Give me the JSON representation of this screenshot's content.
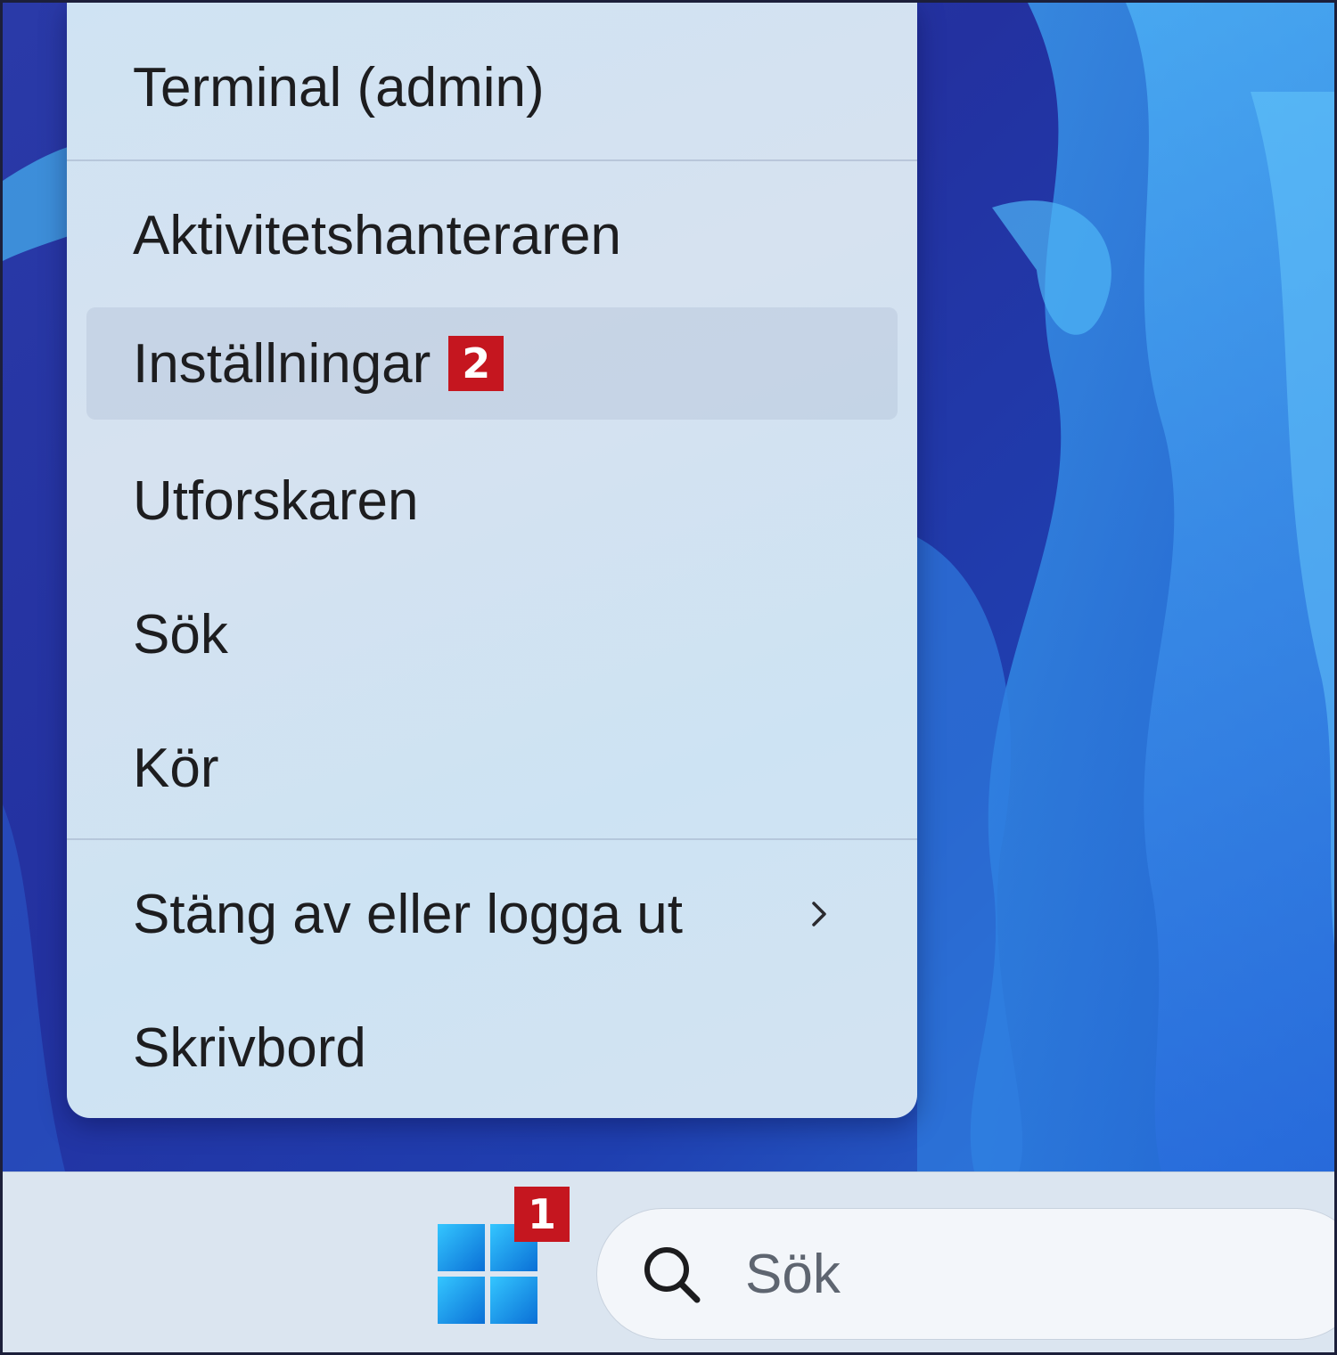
{
  "context_menu": {
    "items": [
      {
        "label": "Terminal (admin)"
      },
      {
        "label": "Aktivitetshanteraren"
      },
      {
        "label": "Inställningar",
        "badge": "2"
      },
      {
        "label": "Utforskaren"
      },
      {
        "label": "Sök"
      },
      {
        "label": "Kör"
      },
      {
        "label": "Stäng av eller logga ut",
        "icon": "chevron-right-icon"
      },
      {
        "label": "Skrivbord"
      }
    ]
  },
  "taskbar": {
    "start_badge": "1",
    "search_placeholder": "Sök"
  },
  "colors": {
    "badge": "#c5161f",
    "menu_bg": "#d3e3f2",
    "taskbar_bg": "#dbe5f0",
    "wallpaper": "#2331a0"
  }
}
